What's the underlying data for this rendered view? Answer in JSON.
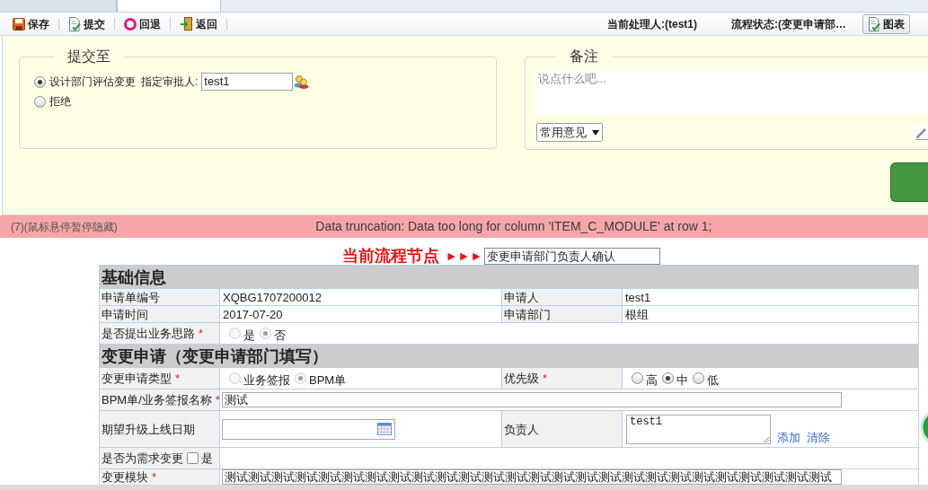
{
  "tabs": [
    {
      "selected": false
    },
    {
      "selected": true
    }
  ],
  "toolbar": {
    "buttons": [
      {
        "kind": "save",
        "label": "保存"
      },
      {
        "kind": "submit",
        "label": "提交"
      },
      {
        "kind": "rollback",
        "label": "回退"
      },
      {
        "kind": "return",
        "label": "返回"
      }
    ],
    "handler": "当前处理人:(test1)",
    "status": "流程状态:(变更申请部…",
    "chart_button": "图表"
  },
  "submit_panel": {
    "legend": "提交至",
    "options": [
      {
        "label": "设计部门评估变更",
        "selected": true,
        "approver_label": "指定审批人:",
        "approver_value": "test1"
      },
      {
        "label": "拒绝",
        "selected": false
      }
    ]
  },
  "remarks_panel": {
    "legend": "备注",
    "placeholder": "说点什么吧...",
    "select": "常用意见"
  },
  "error_bar": {
    "counter": "(7)(鼠标悬停暂停隐藏)",
    "message": "Data truncation: Data too long for column 'ITEM_C_MODULE' at row 1;"
  },
  "flow_node": {
    "label": "当前流程节点",
    "arrows": "►►►",
    "value": "变更申请部门负责人确认"
  },
  "form": {
    "sections": [
      {
        "title": "基础信息",
        "rows": [
          {
            "fields": [
              {
                "label": "申请单编号",
                "content": {
                  "kind": "text",
                  "text": "XQBG1707200012"
                }
              },
              {
                "label": "申请人",
                "content": {
                  "kind": "text",
                  "text": "test1"
                }
              }
            ]
          },
          {
            "fields": [
              {
                "label": "申请时间",
                "content": {
                  "kind": "text",
                  "text": "2017-07-20"
                }
              },
              {
                "label": "申请部门",
                "content": {
                  "kind": "text",
                  "text": "根组"
                }
              }
            ]
          },
          {
            "fields": [
              {
                "label": "是否提出业务思路",
                "mark": "*",
                "content": {
                  "kind": "radios",
                  "disabled": true,
                  "options": [
                    {
                      "label": "是",
                      "selected": false
                    },
                    {
                      "label": "否",
                      "selected": true
                    }
                  ]
                }
              }
            ]
          }
        ]
      },
      {
        "title": "变更申请（变更申请部门填写）",
        "rows": [
          {
            "fields": [
              {
                "label": "变更申请类型",
                "mark": "*",
                "content": {
                  "kind": "radios",
                  "disabled": true,
                  "options": [
                    {
                      "label": "业务签报",
                      "selected": false
                    },
                    {
                      "label": "BPM单",
                      "selected": true
                    }
                  ]
                }
              },
              {
                "label": "优先级",
                "mark": "*",
                "content": {
                  "kind": "radios",
                  "disabled": false,
                  "options": [
                    {
                      "label": "高",
                      "selected": false
                    },
                    {
                      "label": "中",
                      "selected": true
                    },
                    {
                      "label": "低",
                      "selected": false
                    }
                  ]
                }
              }
            ]
          },
          {
            "fields": [
              {
                "label": "BPM单/业务签报名称",
                "mark": "*",
                "content": {
                  "kind": "input",
                  "value": "测试"
                }
              }
            ]
          },
          {
            "fields": [
              {
                "label": "期望升级上线日期",
                "content": {
                  "kind": "date"
                }
              },
              {
                "label": "负责人",
                "content": {
                  "kind": "person",
                  "value": "test1",
                  "links": [
                    "添加",
                    "清除"
                  ]
                }
              }
            ]
          },
          {
            "fields": [
              {
                "label": "是否为需求变更",
                "checkbox": {
                  "label": "是",
                  "checked": false
                }
              }
            ]
          },
          {
            "fields": [
              {
                "label": "变更模块",
                "mark": "*",
                "content": {
                  "kind": "input",
                  "value": "测试测试测试测试测试测试测试测试测试测试测试测试测试测试测试测试测试测试测试测试测试测试测试测试测试测试"
                }
              }
            ]
          }
        ]
      }
    ]
  }
}
